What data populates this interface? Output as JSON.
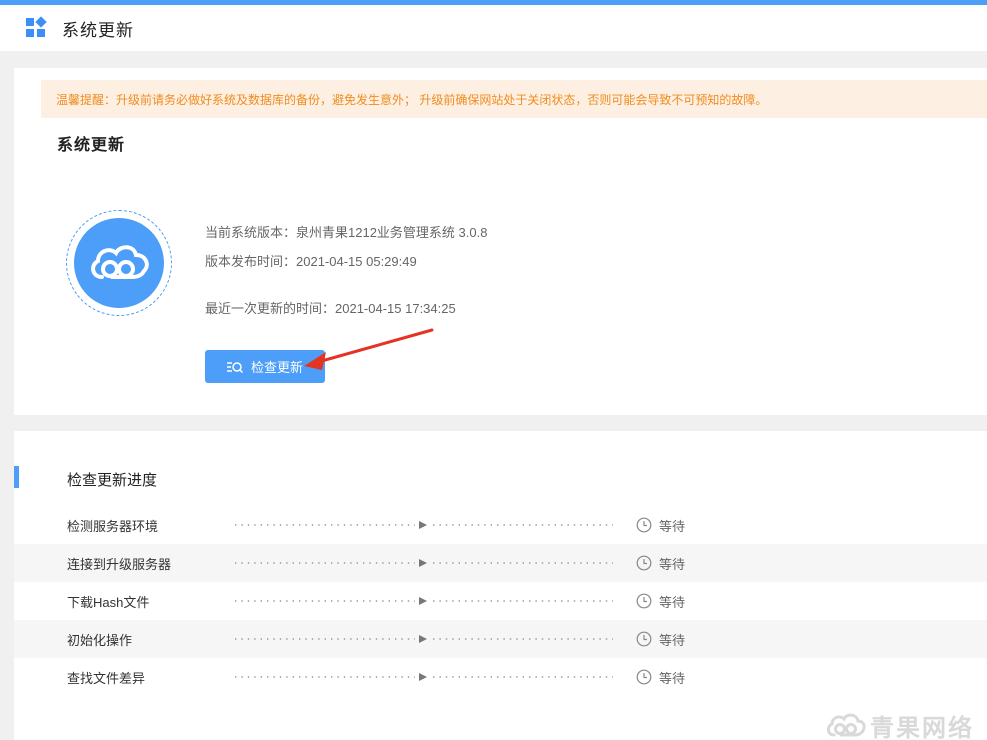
{
  "header": {
    "title": "系统更新",
    "icon": "app-grid-icon"
  },
  "notice": {
    "text": "温馨提醒：升级前请务必做好系统及数据库的备份，避免发生意外；   升级前确保网站处于关闭状态，否则可能会导致不可预知的故障。"
  },
  "update": {
    "title": "系统更新",
    "version": "当前系统版本：泉州青果1212业务管理系统 3.0.8",
    "release_time": "版本发布时间：2021-04-15 05:29:49",
    "last_update": "最近一次更新的时间：2021-04-15 17:34:25",
    "check_button": "检查更新",
    "logo_icon": "cloud-icon"
  },
  "progress": {
    "title": "检查更新进度",
    "steps": [
      {
        "name": "检测服务器环境",
        "status": "等待"
      },
      {
        "name": "连接到升级服务器",
        "status": "等待"
      },
      {
        "name": "下载Hash文件",
        "status": "等待"
      },
      {
        "name": "初始化操作",
        "status": "等待"
      },
      {
        "name": "查找文件差异",
        "status": "等待"
      }
    ]
  },
  "watermark": {
    "text": "青果网络"
  },
  "colors": {
    "accent": "#4c9ef9",
    "notice_bg": "#fdf0e2",
    "notice_text": "#f08c20",
    "arrow": "#e53323"
  }
}
